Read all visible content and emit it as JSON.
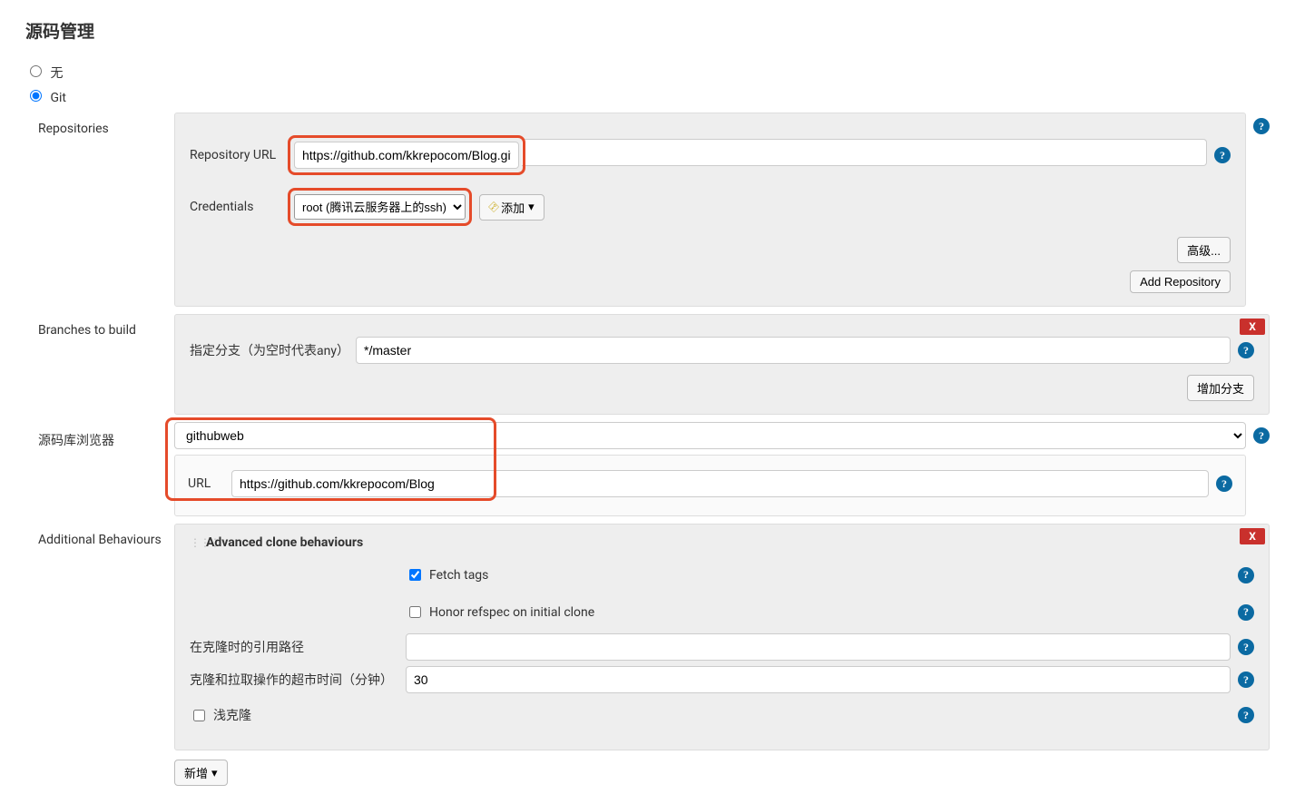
{
  "section_title": "源码管理",
  "scm_options": {
    "none": "无",
    "git": "Git"
  },
  "repositories": {
    "label": "Repositories",
    "repo_url_label": "Repository URL",
    "repo_url_value": "https://github.com/kkrepocom/Blog.git",
    "credentials_label": "Credentials",
    "credentials_selected": "root (腾讯云服务器上的ssh)",
    "add_btn": "添加",
    "advanced_btn": "高级...",
    "add_repo_btn": "Add Repository"
  },
  "branches": {
    "label": "Branches to build",
    "branch_spec_label": "指定分支（为空时代表any）",
    "branch_value": "*/master",
    "add_branch_btn": "增加分支",
    "delete_x": "X"
  },
  "browser": {
    "label": "源码库浏览器",
    "selected": "githubweb",
    "url_label": "URL",
    "url_value": "https://github.com/kkrepocom/Blog"
  },
  "additional": {
    "label": "Additional Behaviours",
    "advanced_clone_title": "Advanced clone behaviours",
    "fetch_tags": "Fetch tags",
    "honor_refspec": "Honor refspec on initial clone",
    "ref_path_label": "在克隆时的引用路径",
    "ref_path_value": "",
    "timeout_label": "克隆和拉取操作的超市时间（分钟）",
    "timeout_value": "30",
    "shallow_label": "浅克隆",
    "delete_x": "X",
    "add_new_btn": "新增"
  },
  "help_glyph": "?"
}
